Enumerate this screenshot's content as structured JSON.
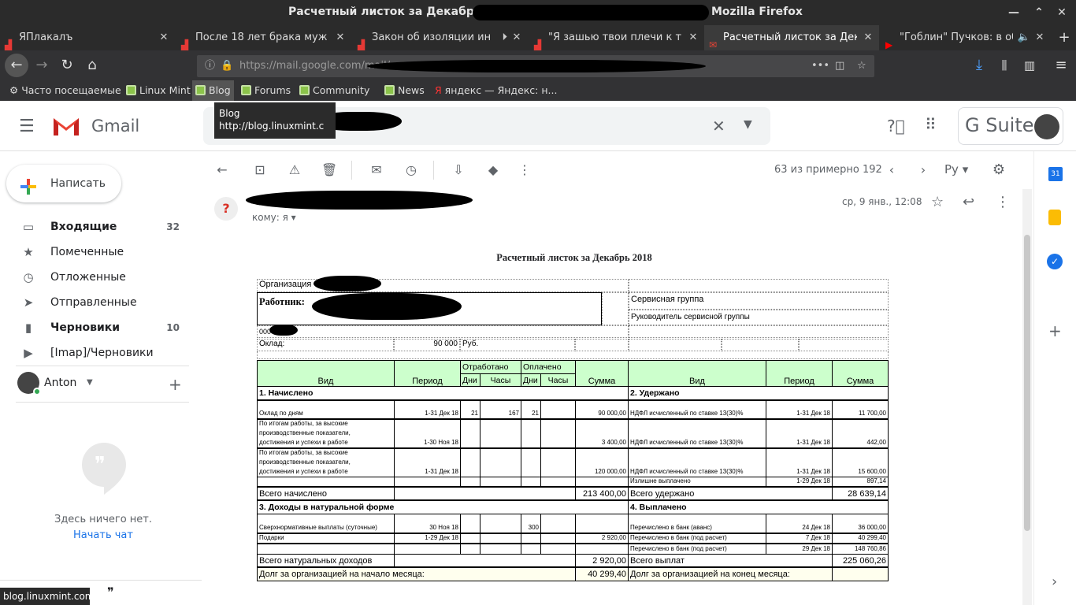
{
  "window": {
    "title_left": "Расчетный листок за Декабрь 20",
    "title_right": "Mozilla Firefox"
  },
  "tabs": [
    {
      "label": "ЯПлакалъ"
    },
    {
      "label": "После 18 лет брака муж и с"
    },
    {
      "label": "Закон об изоляции инте"
    },
    {
      "label": "\"Я зашью твои плечи к тво"
    },
    {
      "label": "Расчетный листок за Декабрь"
    },
    {
      "label": "\"Гоблин\" Пучков: в обще"
    }
  ],
  "url": {
    "text": "https://mail.google.com/mail/"
  },
  "bookmarks": [
    "Часто посещаемые",
    "Linux Mint",
    "Blog",
    "Forums",
    "Community",
    "News",
    "яндекс — Яндекс: н..."
  ],
  "tooltip": {
    "title": "Blog",
    "url": "http://blog.linuxmint.c"
  },
  "gmail": {
    "brand": "Gmail",
    "gsuite": "G Suite",
    "compose": "Написать",
    "nav": [
      {
        "label": "Входящие",
        "count": "32"
      },
      {
        "label": "Помеченные",
        "count": ""
      },
      {
        "label": "Отложенные",
        "count": ""
      },
      {
        "label": "Отправленные",
        "count": ""
      },
      {
        "label": "Черновики",
        "count": "10"
      },
      {
        "label": "[Imap]/Черновики",
        "count": ""
      }
    ],
    "user": "Anton",
    "hangouts_empty": "Здесь ничего нет.",
    "start_chat": "Начать чат",
    "pager": "63 из примерно 192",
    "lang": "Ру"
  },
  "message": {
    "to": "кому: я",
    "date": "ср, 9 янв., 12:08"
  },
  "doc": {
    "title": "Расчетный листок за Декабрь 2018",
    "org_label": "Организация",
    "worker_label": "Работник:",
    "group": "Сервисная группа",
    "position": "Руководитель сервисной группы",
    "code": "000",
    "salary_label": "Оклад:",
    "salary_value": "90 000",
    "salary_unit": "Руб.",
    "hdr_vid": "Вид",
    "hdr_period": "Период",
    "hdr_worked": "Отработано",
    "hdr_paid": "Оплачено",
    "hdr_days": "Дни",
    "hdr_hours": "Часы",
    "hdr_sum": "Сумма",
    "s1": "1. Начислено",
    "s2": "2. Удержано",
    "s3": "3. Доходы в натуральной форме",
    "s4": "4. Выплачено",
    "acc": [
      {
        "vid1": "",
        "vid2": "",
        "vid3": "Оклад по дням",
        "period": "1-31 Дек 18",
        "d": "21",
        "h": "167",
        "pd": "21",
        "ph": "",
        "sum": "90 000,00"
      },
      {
        "vid1": "По итогам работы, за высокие",
        "vid2": "производственные показатели,",
        "vid3": "достижения и успехи в работе",
        "period": "1-30 Ноя 18",
        "d": "",
        "h": "",
        "pd": "",
        "ph": "",
        "sum": "3 400,00"
      },
      {
        "vid1": "По итогам работы, за высокие",
        "vid2": "производственные показатели,",
        "vid3": "достижения и успехи в работе",
        "period": "1-31 Дек 18",
        "d": "",
        "h": "",
        "pd": "",
        "ph": "",
        "sum": "120 000,00"
      }
    ],
    "ded": [
      {
        "vid": "НДФЛ исчисленный по ставке 13(30)%",
        "period": "1-31 Дек 18",
        "sum": "11 700,00"
      },
      {
        "vid": "НДФЛ исчисленный по ставке 13(30)%",
        "period": "1-31 Дек 18",
        "sum": "442,00"
      },
      {
        "vid": "НДФЛ исчисленный по ставке 13(30)%",
        "period": "1-31 Дек 18",
        "sum": "15 600,00"
      },
      {
        "vid": "Излишне выплачено",
        "period": "1-29 Дек 18",
        "sum": "897,14"
      }
    ],
    "total_acc_label": "Всего начислено",
    "total_acc": "213 400,00",
    "total_ded_label": "Всего удержано",
    "total_ded": "28 639,14",
    "nat": [
      {
        "vid": "Сверхнормативные выплаты (суточные)",
        "period": "30 Ноя 18",
        "pd": "300",
        "sum": ""
      },
      {
        "vid": "Подарки",
        "period": "1-29 Дек 18",
        "pd": "",
        "sum": "2 920,00"
      }
    ],
    "paid": [
      {
        "vid": "Перечислено в банк (аванс)",
        "period": "24 Дек 18",
        "sum": "36 000,00"
      },
      {
        "vid": "Перечислено в банк (под расчет)",
        "period": "7 Дек 18",
        "sum": "40 299,40"
      },
      {
        "vid": "Перечислено в банк (под расчет)",
        "period": "29 Дек 18",
        "sum": "148 760,86"
      }
    ],
    "total_nat_label": "Всего натуральных доходов",
    "total_nat": "2 920,00",
    "total_paid_label": "Всего выплат",
    "total_paid": "225 060,26",
    "debt_start_label": "Долг за организацией на начало месяца:",
    "debt_start": "40 299,40",
    "debt_end_label": "Долг за организацией на конец месяца:"
  },
  "statusbar": "blog.linuxmint.com"
}
